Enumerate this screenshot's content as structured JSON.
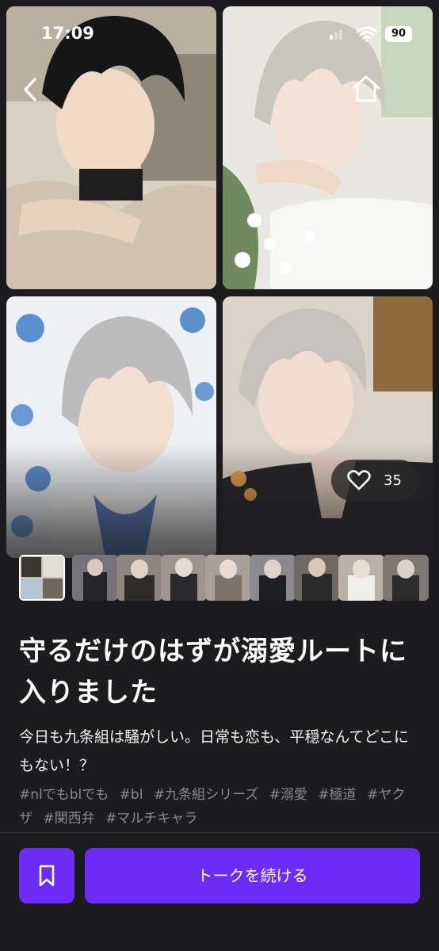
{
  "status_bar": {
    "time": "17:09",
    "battery": "90"
  },
  "nav": {
    "back_icon": "chevron-left-icon",
    "home_icon": "home-icon"
  },
  "gallery": {
    "images": [
      {
        "name": "gallery-image-dark-hair-boy"
      },
      {
        "name": "gallery-image-silver-hair-flowers"
      },
      {
        "name": "gallery-image-silver-hair-blue-flowers"
      },
      {
        "name": "gallery-image-silver-hair-suit"
      }
    ]
  },
  "likes": {
    "icon": "heart-icon",
    "count": "35"
  },
  "thumbnails": [
    {
      "name": "thumbnail-collage",
      "selected": true
    },
    {
      "name": "thumbnail-2"
    },
    {
      "name": "thumbnail-3"
    },
    {
      "name": "thumbnail-4"
    },
    {
      "name": "thumbnail-5"
    },
    {
      "name": "thumbnail-6"
    },
    {
      "name": "thumbnail-7"
    },
    {
      "name": "thumbnail-8"
    },
    {
      "name": "thumbnail-9"
    }
  ],
  "story": {
    "title": "守るだけのはずが溺愛ルートに入りました",
    "description": "今日も九条組は騒がしい。日常も恋も、平穏なんてどこにもない！？",
    "tags": [
      "#nlでもblでも",
      "#bl",
      "#九条組シリーズ",
      "#溺愛",
      "#極道",
      "#ヤクザ",
      "#関西弁",
      "#マルチキャラ"
    ]
  },
  "actions": {
    "bookmark_icon": "bookmark-icon",
    "continue_label": "トークを続ける"
  },
  "colors": {
    "accent": "#6c2cf6",
    "background": "#1c1c1e",
    "tag": "#8a8a8e"
  }
}
